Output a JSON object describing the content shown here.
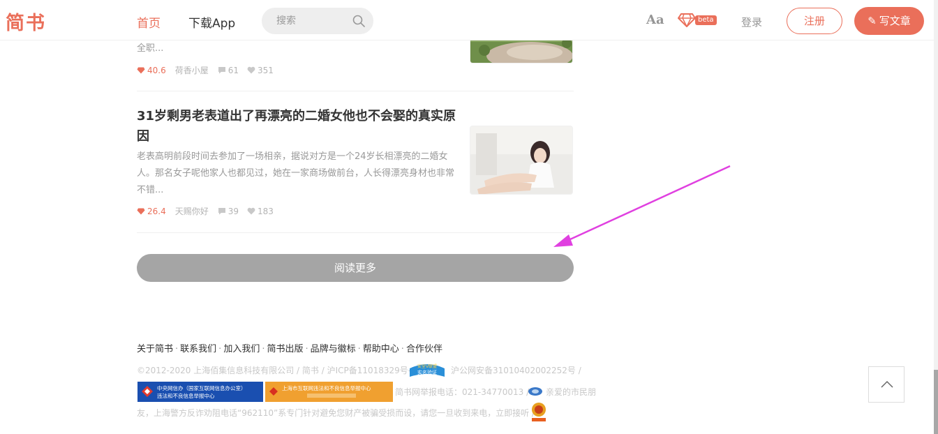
{
  "header": {
    "logo": "简书",
    "nav_home": "首页",
    "nav_app": "下载App",
    "search_placeholder": "搜索",
    "aa_label": "Aa",
    "beta_label": "beta",
    "login_label": "登录",
    "register_label": "注册",
    "write_label": "写文章",
    "brand_color": "#ea6f5a"
  },
  "articles": [
    {
      "abstract_tail": "全职...",
      "jsd": "40.6",
      "author": "荷香小屋",
      "comments": "61",
      "likes": "351"
    },
    {
      "title": "31岁剩男老表道出了再漂亮的二婚女他也不会娶的真实原因",
      "abstract": "老表高明前段时间去参加了一场相亲，据说对方是一个24岁长相漂亮的二婚女人。那名女子呢他家人也都见过，她在一家商场做前台，人长得漂亮身材也非常不错...",
      "jsd": "26.4",
      "author": "天赐你好",
      "comments": "39",
      "likes": "183"
    }
  ],
  "load_more_label": "阅读更多",
  "footer": {
    "links": [
      "关于简书",
      "联系我们",
      "加入我们",
      "简书出版",
      "品牌与徽标",
      "帮助中心",
      "合作伙伴"
    ],
    "copyright": "©2012-2020 上海佰集信息科技有限公司 / 简书 / 沪ICP备11018329号-5 /",
    "police": "沪公网安备31010402002252号 /",
    "badge1_line1": "中央网信办（国家互联网信息办公室）",
    "badge1_line2": "违法和不良信息举报中心",
    "badge2_line1": "上海市互联网违法和不良信息举报中心",
    "report_phone": "简书网举报电话：021-34770013 /",
    "citizen": "亲爱的市民朋",
    "line3": "友，上海警方反诈劝阻电话“962110”系专门针对避免您财产被骗受损而设，请您一旦收到来电，立即接听 /",
    "vbadge_line1": "安全V联盟",
    "vbadge_line2": "实名验证"
  },
  "icons": {
    "search": "search-icon",
    "diamond": "diamond-icon",
    "comment": "comment-icon",
    "heart": "heart-icon",
    "back_to_top": "chevron-up-icon"
  },
  "annotation_arrow_color": "#e040e0"
}
